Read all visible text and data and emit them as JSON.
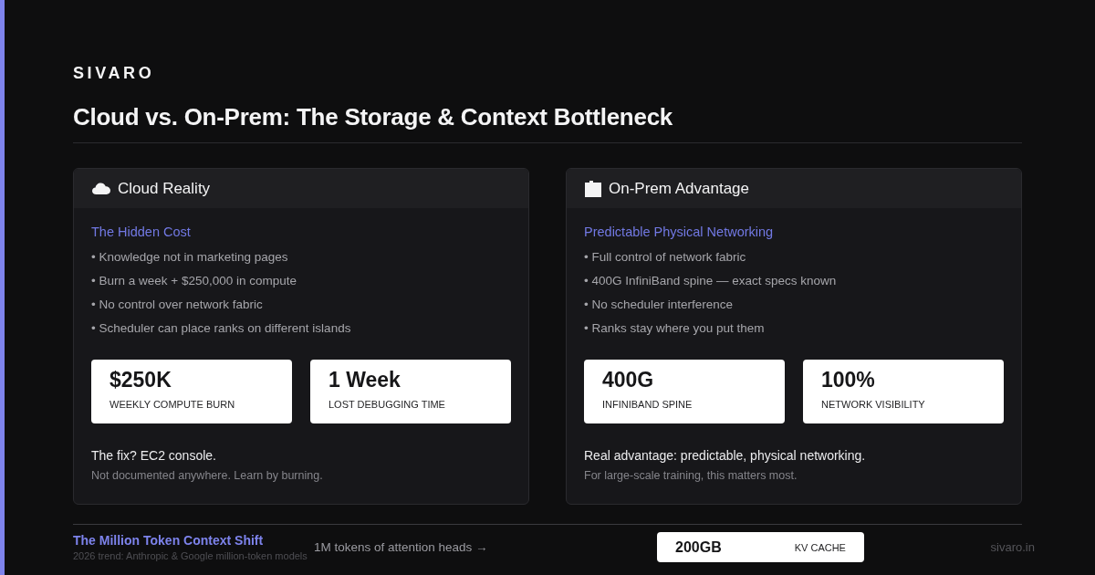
{
  "brand": "SIVARO",
  "title": "Cloud vs. On-Prem: The Storage & Context Bottleneck",
  "cards": [
    {
      "kind": "cloud",
      "heading": "Cloud Reality",
      "subheading": "The Hidden Cost",
      "bullets": [
        "• Knowledge not in marketing pages",
        "• Burn a week + $250,000 in compute",
        "• No control over network fabric",
        "• Scheduler can place ranks on different islands"
      ],
      "stats": [
        {
          "value": "$250K",
          "label": "WEEKLY COMPUTE BURN"
        },
        {
          "value": "1 Week",
          "label": "LOST DEBUGGING TIME"
        }
      ],
      "takeaway": "The fix? EC2 console.",
      "note": "Not documented anywhere. Learn by burning."
    },
    {
      "kind": "onprem",
      "heading": "On-Prem Advantage",
      "subheading": "Predictable Physical Networking",
      "bullets": [
        "• Full control of network fabric",
        "• 400G InfiniBand spine — exact specs known",
        "• No scheduler interference",
        "• Ranks stay where you put them"
      ],
      "stats": [
        {
          "value": "400G",
          "label": "INFINIBAND SPINE"
        },
        {
          "value": "100%",
          "label": "NETWORK VISIBILITY"
        }
      ],
      "takeaway": "Real advantage: predictable, physical networking.",
      "note": "For large-scale training, this matters most."
    }
  ],
  "footer": {
    "title": "The Million Token Context Shift",
    "subtitle": "2026 trend: Anthropic & Google million-token models",
    "caption": "1M tokens of attention heads →",
    "stat": {
      "value": "200GB",
      "label": "KV CACHE"
    },
    "site": "sivaro.in"
  }
}
